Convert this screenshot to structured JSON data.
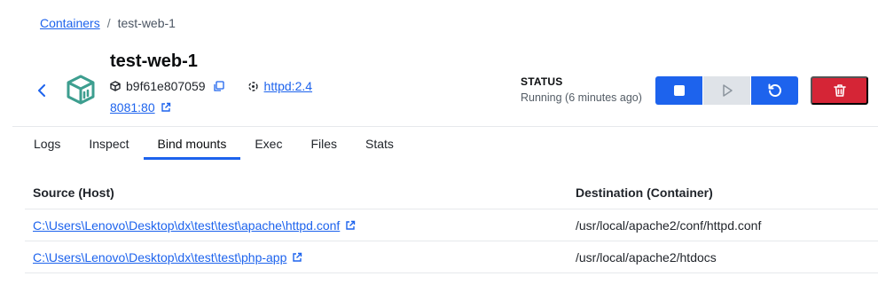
{
  "breadcrumb": {
    "root": "Containers",
    "separator": "/",
    "current": "test-web-1"
  },
  "header": {
    "title": "test-web-1",
    "container_id": "b9f61e807059",
    "image": "httpd:2.4",
    "port": "8081:80",
    "status_label": "STATUS",
    "status_value": "Running (6 minutes ago)"
  },
  "tabs": [
    {
      "label": "Logs",
      "active": false
    },
    {
      "label": "Inspect",
      "active": false
    },
    {
      "label": "Bind mounts",
      "active": true
    },
    {
      "label": "Exec",
      "active": false
    },
    {
      "label": "Files",
      "active": false
    },
    {
      "label": "Stats",
      "active": false
    }
  ],
  "table": {
    "headers": {
      "source": "Source (Host)",
      "destination": "Destination (Container)"
    },
    "rows": [
      {
        "source": "C:\\Users\\Lenovo\\Desktop\\dx\\test\\test\\apache\\httpd.conf",
        "destination": "/usr/local/apache2/conf/httpd.conf"
      },
      {
        "source": "C:\\Users\\Lenovo\\Desktop\\dx\\test\\test\\php-app",
        "destination": "/usr/local/apache2/htdocs"
      }
    ]
  },
  "colors": {
    "accent": "#1d63ed",
    "danger": "#d52536",
    "container_icon": "#3d9e8f",
    "disabled": "#dfe3e8"
  },
  "icons": {
    "back": "chevron-left-icon",
    "container": "container-box-icon",
    "id": "cube-icon",
    "copy": "copy-icon",
    "image": "image-layers-icon",
    "external": "external-link-icon",
    "stop": "stop-icon",
    "start": "play-icon",
    "restart": "restart-icon",
    "delete": "trash-icon"
  }
}
